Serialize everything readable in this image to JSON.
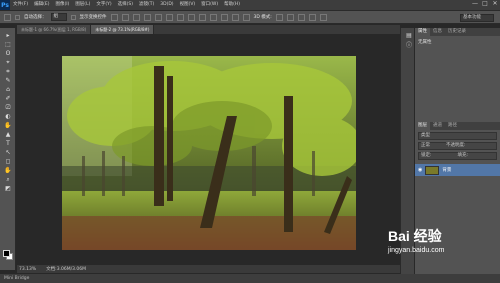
{
  "app": {
    "logo": "Ps"
  },
  "menu": [
    "文件(F)",
    "编辑(E)",
    "图像(I)",
    "图层(L)",
    "文字(Y)",
    "选择(S)",
    "滤镜(T)",
    "3D(D)",
    "视图(V)",
    "窗口(W)",
    "帮助(H)"
  ],
  "window_controls": [
    "—",
    "□",
    "✕"
  ],
  "options": {
    "auto_select_label": "自动选择：",
    "auto_select_value": "组",
    "show_transform_label": "显示变换控件",
    "workspace": "基本功能"
  },
  "tabs": [
    "未标题-1 @ 66.7%(图层 1, RGB/8)",
    "未标题-2 @ 73.1%(RGB/8#)"
  ],
  "tools": [
    "▸",
    "⬚",
    "ʘ",
    "⌖",
    "⌗",
    "✎",
    "⌂",
    "✐",
    "⎚",
    "◐",
    "✋",
    "▲",
    "T",
    "↖",
    "◻",
    "✋",
    "⌕",
    "◩"
  ],
  "status": {
    "zoom": "73.13%",
    "doc_size": "文档:3.06M/3.06M"
  },
  "bottom_bar": "Mini Bridge",
  "right": {
    "props_tabs": [
      "属性",
      "信息",
      "历史记录"
    ],
    "props_body": "无属性",
    "layers_tabs": [
      "图层",
      "通道",
      "路径"
    ],
    "kind_label": "类型",
    "blend_mode": "正常",
    "opacity_label": "不透明度:",
    "lock_label": "锁定:",
    "fill_label": "填充:",
    "layer_name": "背景"
  },
  "watermark": {
    "logo": "Bai 经验",
    "url": "jingyan.baidu.com"
  }
}
